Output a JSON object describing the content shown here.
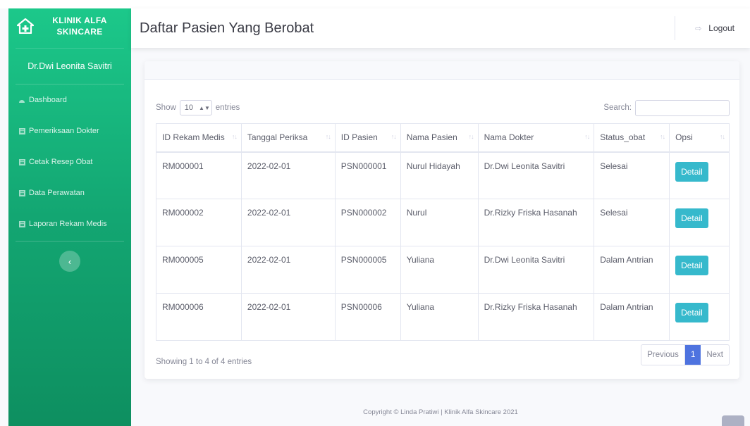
{
  "brand": {
    "name_line1": "KLINIK ALFA",
    "name_line2": "SKINCARE",
    "icon": "clinic-house-icon"
  },
  "sidebar": {
    "doctor_name": "Dr.Dwi Leonita Savitri",
    "items": [
      {
        "label": "Dashboard",
        "icon": "dashboard-icon"
      },
      {
        "label": "Pemeriksaan Dokter",
        "icon": "list-icon"
      },
      {
        "label": "Cetak Resep Obat",
        "icon": "list-icon"
      },
      {
        "label": "Data Perawatan",
        "icon": "list-icon"
      },
      {
        "label": "Laporan Rekam Medis",
        "icon": "list-icon"
      }
    ],
    "toggle_icon": "chevron-left-icon"
  },
  "topbar": {
    "title": "Daftar Pasien Yang Berobat",
    "logout_label": "Logout",
    "logout_icon": "sign-out-icon"
  },
  "table_controls": {
    "show_label": "Show",
    "entries_value": "10",
    "entries_label": "entries",
    "search_label": "Search:"
  },
  "table": {
    "columns": [
      "ID Rekam Medis",
      "Tanggal Periksa",
      "ID Pasien",
      "Nama Pasien",
      "Nama Dokter",
      "Status_obat",
      "Opsi"
    ],
    "rows": [
      {
        "id": "RM000001",
        "date": "2022-02-01",
        "patient_id": "PSN000001",
        "patient": "Nurul Hidayah",
        "doctor": "Dr.Dwi Leonita Savitri",
        "status": "Selesai",
        "action": "Detail"
      },
      {
        "id": "RM000002",
        "date": "2022-02-01",
        "patient_id": "PSN000002",
        "patient": "Nurul",
        "doctor": "Dr.Rizky Friska Hasanah",
        "status": "Selesai",
        "action": "Detail"
      },
      {
        "id": "RM000005",
        "date": "2022-02-01",
        "patient_id": "PSN000005",
        "patient": "Yuliana",
        "doctor": "Dr.Dwi Leonita Savitri",
        "status": "Dalam Antrian",
        "action": "Detail"
      },
      {
        "id": "RM000006",
        "date": "2022-02-01",
        "patient_id": "PSN00006",
        "patient": "Yuliana",
        "doctor": "Dr.Rizky Friska Hasanah",
        "status": "Dalam Antrian",
        "action": "Detail"
      }
    ]
  },
  "pagination": {
    "info": "Showing 1 to 4 of 4 entries",
    "previous": "Previous",
    "current_page": "1",
    "next": "Next"
  },
  "footer": {
    "copyright": "Copyright © Linda Pratiwi | Klinik Alfa Skincare 2021"
  },
  "colors": {
    "sidebar": "#1cc88a",
    "detail_button": "#36b9cc",
    "active_page": "#4e73df"
  }
}
